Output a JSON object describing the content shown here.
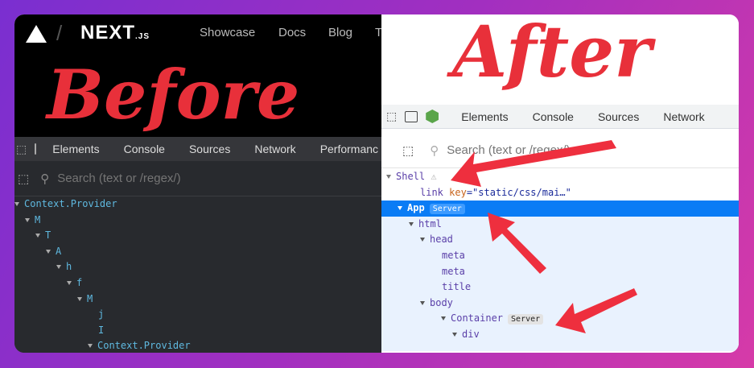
{
  "before": {
    "heading": "Before",
    "nav": {
      "logo": "NEXT",
      "logo_suffix": ".JS",
      "links": [
        "Showcase",
        "Docs",
        "Blog",
        "T"
      ]
    },
    "tabs": [
      "Elements",
      "Console",
      "Sources",
      "Network",
      "Performanc"
    ],
    "search_placeholder": "Search (text or /regex/)",
    "tree": [
      {
        "label": "Context.Provider",
        "depth": 0,
        "arrow": true
      },
      {
        "label": "M",
        "depth": 1,
        "arrow": true
      },
      {
        "label": "T",
        "depth": 2,
        "arrow": true
      },
      {
        "label": "A",
        "depth": 3,
        "arrow": true
      },
      {
        "label": "h",
        "depth": 4,
        "arrow": true
      },
      {
        "label": "f",
        "depth": 5,
        "arrow": true
      },
      {
        "label": "M",
        "depth": 6,
        "arrow": true
      },
      {
        "label": "j",
        "depth": 7,
        "arrow": false
      },
      {
        "label": "I",
        "depth": 7,
        "arrow": false
      },
      {
        "label": "Context.Provider",
        "depth": 7,
        "arrow": true
      }
    ]
  },
  "after": {
    "heading": "After",
    "tabs": [
      "Elements",
      "Console",
      "Sources",
      "Network"
    ],
    "search_placeholder": "Search (text or /regex/)",
    "tree": {
      "shell": "Shell",
      "link_tag": "link",
      "link_attr": "key",
      "link_value": "=\"static/css/mai…\"",
      "app": "App",
      "server_badge": "Server",
      "items": [
        {
          "label": "html",
          "depth": 2
        },
        {
          "label": "head",
          "depth": 3
        },
        {
          "label": "meta",
          "depth": 4
        },
        {
          "label": "meta",
          "depth": 4
        },
        {
          "label": "title",
          "depth": 4
        },
        {
          "label": "body",
          "depth": 3
        }
      ],
      "container": "Container",
      "div": "div"
    }
  },
  "colors": {
    "accent": "#e8303a",
    "selection": "#0a7cf5",
    "tree_dark": "#5fb9e0"
  }
}
